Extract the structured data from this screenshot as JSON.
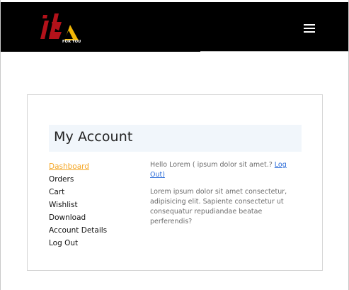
{
  "header": {
    "logo_text": "ib",
    "logo_sub": "FOR YOU",
    "menu_icon": "hamburger-icon"
  },
  "account": {
    "title": "My Account",
    "nav": [
      {
        "label": "Dashboard",
        "active": true
      },
      {
        "label": "Orders"
      },
      {
        "label": "Cart"
      },
      {
        "label": "Wishlist"
      },
      {
        "label": "Download"
      },
      {
        "label": "Account Details"
      },
      {
        "label": "Log Out"
      }
    ],
    "greeting": "Hello Lorem ( ipsum dolor sit amet.?",
    "logout_link": "Log Out)",
    "description": "Lorem ipsum dolor sit amet consectetur, adipisicing elit. Sapiente consectetur ut consequatur repudiandae beatae perferendis?"
  },
  "colors": {
    "header_bg": "#000000",
    "accent": "#f5a623",
    "logo_red": "#b3121a",
    "logo_yellow": "#f2b705",
    "link": "#2b6cd8",
    "title_bar_bg": "#f1f6fb"
  }
}
